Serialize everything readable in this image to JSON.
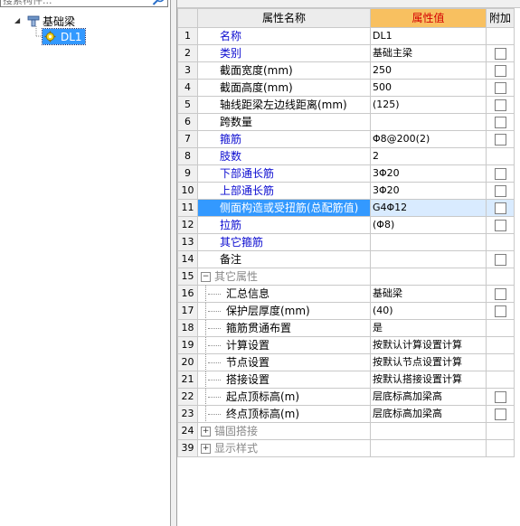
{
  "tree": {
    "search_placeholder": "搜索构件...",
    "root_label": "基础梁",
    "child_label": "DL1",
    "expand_glyph": "◢"
  },
  "grid": {
    "header": {
      "num": "",
      "name": "属性名称",
      "value": "属性值",
      "extra": "附加"
    },
    "rows": [
      {
        "num": "1",
        "name": "名称",
        "value": "DL1",
        "check": false,
        "style": "blue"
      },
      {
        "num": "2",
        "name": "类别",
        "value": "基础主梁",
        "check": true,
        "style": "blue"
      },
      {
        "num": "3",
        "name": "截面宽度(mm)",
        "value": "250",
        "check": true,
        "style": ""
      },
      {
        "num": "4",
        "name": "截面高度(mm)",
        "value": "500",
        "check": true,
        "style": ""
      },
      {
        "num": "5",
        "name": "轴线距梁左边线距离(mm)",
        "value": "(125)",
        "check": true,
        "style": ""
      },
      {
        "num": "6",
        "name": "跨数量",
        "value": "",
        "check": true,
        "style": ""
      },
      {
        "num": "7",
        "name": "箍筋",
        "value": "Φ8@200(2)",
        "check": true,
        "style": "blue"
      },
      {
        "num": "8",
        "name": "肢数",
        "value": "2",
        "check": false,
        "style": "blue"
      },
      {
        "num": "9",
        "name": "下部通长筋",
        "value": "3Φ20",
        "check": true,
        "style": "blue"
      },
      {
        "num": "10",
        "name": "上部通长筋",
        "value": "3Φ20",
        "check": true,
        "style": "blue"
      },
      {
        "num": "11",
        "name": "侧面构造或受扭筋(总配筋值)",
        "value": "G4Φ12",
        "check": true,
        "style": "selected"
      },
      {
        "num": "12",
        "name": "拉筋",
        "value": "(Φ8)",
        "check": true,
        "style": "blue"
      },
      {
        "num": "13",
        "name": "其它箍筋",
        "value": "",
        "check": false,
        "style": "blue"
      },
      {
        "num": "14",
        "name": "备注",
        "value": "",
        "check": true,
        "style": ""
      },
      {
        "num": "15",
        "name": "其它属性",
        "value": "",
        "check": false,
        "style": "group-open"
      },
      {
        "num": "16",
        "name": "汇总信息",
        "value": "基础梁",
        "check": true,
        "style": "child"
      },
      {
        "num": "17",
        "name": "保护层厚度(mm)",
        "value": "(40)",
        "check": true,
        "style": "child"
      },
      {
        "num": "18",
        "name": "箍筋贯通布置",
        "value": "是",
        "check": false,
        "style": "child"
      },
      {
        "num": "19",
        "name": "计算设置",
        "value": "按默认计算设置计算",
        "check": false,
        "style": "child"
      },
      {
        "num": "20",
        "name": "节点设置",
        "value": "按默认节点设置计算",
        "check": false,
        "style": "child"
      },
      {
        "num": "21",
        "name": "搭接设置",
        "value": "按默认搭接设置计算",
        "check": false,
        "style": "child"
      },
      {
        "num": "22",
        "name": "起点顶标高(m)",
        "value": "层底标高加梁高",
        "check": true,
        "style": "child"
      },
      {
        "num": "23",
        "name": "终点顶标高(m)",
        "value": "层底标高加梁高",
        "check": true,
        "style": "child"
      },
      {
        "num": "24",
        "name": "锚固搭接",
        "value": "",
        "check": false,
        "style": "group-closed"
      },
      {
        "num": "39",
        "name": "显示样式",
        "value": "",
        "check": false,
        "style": "group-closed"
      }
    ]
  }
}
